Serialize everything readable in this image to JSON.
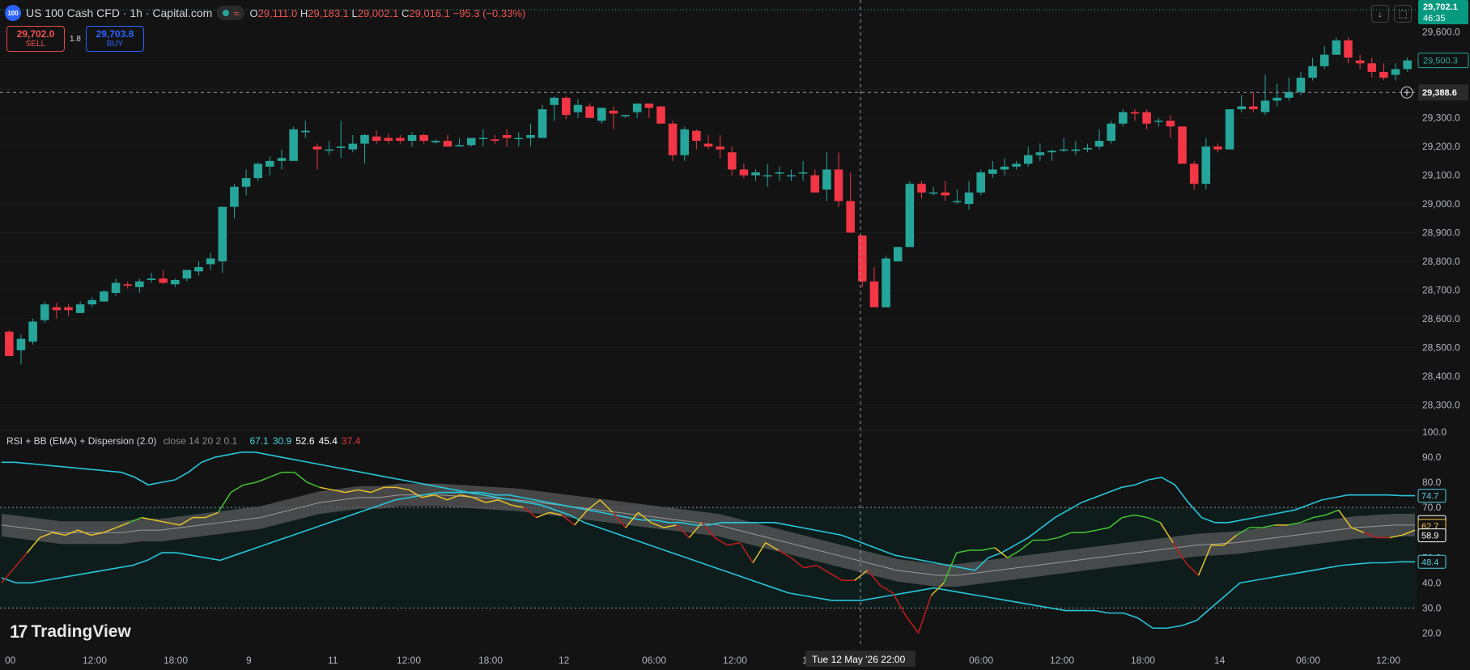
{
  "header": {
    "symbol_badge": "100",
    "title": "US 100 Cash CFD · 1h · Capital.com",
    "wave_icon": "≈",
    "ohlc": {
      "o_label": "O",
      "o": "29,111.0",
      "h_label": "H",
      "h": "29,183.1",
      "l_label": "L",
      "l": "29,002.1",
      "c_label": "C",
      "c": "29,016.1",
      "change": "−95.3 (−0.33%)"
    }
  },
  "trade": {
    "sell_price": "29,702.0",
    "sell_label": "SELL",
    "spread": "1.8",
    "buy_price": "29,703.8",
    "buy_label": "BUY"
  },
  "toolbar": {
    "arrow_icon": "↓",
    "frame_icon": "⬚"
  },
  "price_axis": {
    "ticks": [
      "29,600.0",
      "29,500.0",
      "29,400.0",
      "29,300.0",
      "29,200.0",
      "29,100.0",
      "29,000.0",
      "28,900.0",
      "28,800.0",
      "28,700.0",
      "28,600.0",
      "28,500.0",
      "28,400.0",
      "28,300.0"
    ],
    "current_price": "29,702.1",
    "countdown": "46:35",
    "marker_label": "29,500.3",
    "crosshair_label": "29,388.6"
  },
  "indicator": {
    "name": "RSI + BB (EMA) + Dispersion (2.0)",
    "params": "close 14 20 2 0.1",
    "values": [
      {
        "text": "67.1",
        "color": "#4dd0e1"
      },
      {
        "text": "30.9",
        "color": "#4dd0e1"
      },
      {
        "text": "52.6",
        "color": "#ffffff"
      },
      {
        "text": "45.4",
        "color": "#ffffff"
      },
      {
        "text": "37.4",
        "color": "#e53935"
      }
    ],
    "ticks": [
      "100.0",
      "90.0",
      "80.0",
      "70.0",
      "60.0",
      "50.0",
      "40.0",
      "30.0",
      "20.0"
    ],
    "labels": [
      {
        "text": "74.7",
        "v": 74.7,
        "bg": "#131313",
        "color": "#4dd0e1",
        "border": "#4dd0e1"
      },
      {
        "text": "64.2",
        "v": 64.2,
        "bg": "#131313",
        "color": "#ffffff",
        "border": "#ffffff"
      },
      {
        "text": "62.7",
        "v": 62.7,
        "bg": "#131313",
        "color": "#f5c542",
        "border": "#f5c542"
      },
      {
        "text": "58.9",
        "v": 58.9,
        "bg": "#131313",
        "color": "#ffffff",
        "border": "#ffffff"
      },
      {
        "text": "48.4",
        "v": 48.4,
        "bg": "#131313",
        "color": "#4dd0e1",
        "border": "#4dd0e1"
      }
    ]
  },
  "time_axis": {
    "labels": [
      "00",
      "12:00",
      "18:00",
      "9",
      "11",
      "12:00",
      "18:00",
      "12",
      "06:00",
      "12:00",
      "18",
      "22:00",
      "06:00",
      "12:00",
      "18:00",
      "14",
      "06:00",
      "12:00"
    ],
    "crosshair_label": "Tue 12 May '26  22:00"
  },
  "branding": {
    "name": "TradingView"
  },
  "colors": {
    "up": "#26a69a",
    "down": "#f23645",
    "bb": "#26c6da",
    "rsi_up": "#43c331",
    "rsi_mid": "#e6c229",
    "rsi_down": "#c41c1c",
    "band": "#5a5a5a",
    "accent": "#089981"
  },
  "chart_data": {
    "type": "candlestick",
    "price_ylim": [
      28250,
      29660
    ],
    "rsi_ylim": [
      15,
      100
    ],
    "candles": [
      [
        28555,
        28560,
        28470,
        28470
      ],
      [
        28490,
        28545,
        28440,
        28530
      ],
      [
        28520,
        28600,
        28510,
        28590
      ],
      [
        28595,
        28660,
        28585,
        28650
      ],
      [
        28640,
        28655,
        28600,
        28630
      ],
      [
        28640,
        28650,
        28610,
        28630
      ],
      [
        28620,
        28660,
        28620,
        28650
      ],
      [
        28650,
        28675,
        28640,
        28665
      ],
      [
        28660,
        28700,
        28660,
        28695
      ],
      [
        28690,
        28740,
        28680,
        28725
      ],
      [
        28720,
        28730,
        28705,
        28715
      ],
      [
        28710,
        28740,
        28690,
        28730
      ],
      [
        28735,
        28760,
        28725,
        28740
      ],
      [
        28740,
        28770,
        28720,
        28725
      ],
      [
        28720,
        28740,
        28710,
        28735
      ],
      [
        28740,
        28770,
        28730,
        28770
      ],
      [
        28765,
        28800,
        28750,
        28780
      ],
      [
        28790,
        28830,
        28770,
        28810
      ],
      [
        28800,
        28990,
        28760,
        28990
      ],
      [
        28990,
        29070,
        28950,
        29060
      ],
      [
        29060,
        29120,
        29030,
        29090
      ],
      [
        29090,
        29145,
        29080,
        29140
      ],
      [
        29130,
        29165,
        29100,
        29150
      ],
      [
        29150,
        29190,
        29120,
        29160
      ],
      [
        29150,
        29270,
        29150,
        29260
      ],
      [
        29250,
        29290,
        29230,
        29255
      ],
      [
        29200,
        29210,
        29120,
        29190
      ],
      [
        29190,
        29220,
        29170,
        29190
      ],
      [
        29195,
        29290,
        29160,
        29200
      ],
      [
        29190,
        29240,
        29180,
        29210
      ],
      [
        29210,
        29245,
        29140,
        29240
      ],
      [
        29235,
        29255,
        29210,
        29220
      ],
      [
        29230,
        29245,
        29210,
        29220
      ],
      [
        29230,
        29240,
        29210,
        29220
      ],
      [
        29220,
        29250,
        29200,
        29240
      ],
      [
        29240,
        29245,
        29210,
        29220
      ],
      [
        29215,
        29225,
        29210,
        29220
      ],
      [
        29220,
        29240,
        29200,
        29200
      ],
      [
        29205,
        29230,
        29200,
        29205
      ],
      [
        29205,
        29230,
        29200,
        29230
      ],
      [
        29230,
        29260,
        29200,
        29230
      ],
      [
        29225,
        29240,
        29210,
        29220
      ],
      [
        29240,
        29260,
        29200,
        29230
      ],
      [
        29230,
        29250,
        29200,
        29230
      ],
      [
        29230,
        29280,
        29200,
        29240
      ],
      [
        29230,
        29345,
        29230,
        29330
      ],
      [
        29345,
        29375,
        29290,
        29370
      ],
      [
        29370,
        29375,
        29295,
        29310
      ],
      [
        29320,
        29365,
        29300,
        29345
      ],
      [
        29340,
        29350,
        29300,
        29300
      ],
      [
        29290,
        29330,
        29280,
        29335
      ],
      [
        29325,
        29340,
        29260,
        29315
      ],
      [
        29310,
        29310,
        29300,
        29310
      ],
      [
        29320,
        29340,
        29300,
        29350
      ],
      [
        29350,
        29350,
        29300,
        29335
      ],
      [
        29340,
        29330,
        29280,
        29280
      ],
      [
        29280,
        29290,
        29150,
        29170
      ],
      [
        29170,
        29270,
        29150,
        29260
      ],
      [
        29255,
        29260,
        29190,
        29220
      ],
      [
        29210,
        29240,
        29190,
        29200
      ],
      [
        29200,
        29240,
        29160,
        29190
      ],
      [
        29180,
        29200,
        29100,
        29120
      ],
      [
        29120,
        29140,
        29090,
        29100
      ],
      [
        29100,
        29120,
        29080,
        29110
      ],
      [
        29100,
        29140,
        29060,
        29100
      ],
      [
        29110,
        29130,
        29080,
        29110
      ],
      [
        29100,
        29120,
        29080,
        29100
      ],
      [
        29110,
        29150,
        29080,
        29110
      ],
      [
        29100,
        29120,
        29040,
        29040
      ],
      [
        29050,
        29180,
        29010,
        29120
      ],
      [
        29120,
        29180,
        28990,
        29010
      ],
      [
        29010,
        29110,
        28900,
        28900
      ],
      [
        28890,
        28890,
        28710,
        28730
      ],
      [
        28730,
        28780,
        28640,
        28640
      ],
      [
        28640,
        28820,
        28640,
        28810
      ],
      [
        28800,
        28850,
        28800,
        28850
      ],
      [
        28850,
        29080,
        28850,
        29070
      ],
      [
        29070,
        29080,
        29020,
        29040
      ],
      [
        29040,
        29060,
        29030,
        29040
      ],
      [
        29040,
        29080,
        29010,
        29030
      ],
      [
        29010,
        29050,
        29000,
        29010
      ],
      [
        29000,
        29080,
        28980,
        29040
      ],
      [
        29040,
        29120,
        29030,
        29110
      ],
      [
        29105,
        29150,
        29090,
        29120
      ],
      [
        29120,
        29160,
        29100,
        29130
      ],
      [
        29130,
        29150,
        29120,
        29140
      ],
      [
        29140,
        29200,
        29130,
        29170
      ],
      [
        29170,
        29210,
        29150,
        29180
      ],
      [
        29180,
        29190,
        29150,
        29185
      ],
      [
        29190,
        29230,
        29180,
        29190
      ],
      [
        29185,
        29220,
        29170,
        29190
      ],
      [
        29190,
        29210,
        29180,
        29195
      ],
      [
        29200,
        29260,
        29190,
        29220
      ],
      [
        29220,
        29290,
        29210,
        29280
      ],
      [
        29280,
        29330,
        29270,
        29320
      ],
      [
        29320,
        29330,
        29290,
        29315
      ],
      [
        29320,
        29330,
        29260,
        29280
      ],
      [
        29290,
        29300,
        29270,
        29290
      ],
      [
        29290,
        29310,
        29230,
        29270
      ],
      [
        29270,
        29260,
        29180,
        29140
      ],
      [
        29140,
        29150,
        29050,
        29070
      ],
      [
        29070,
        29230,
        29050,
        29200
      ],
      [
        29200,
        29210,
        29180,
        29190
      ],
      [
        29190,
        29330,
        29190,
        29330
      ],
      [
        29330,
        29380,
        29320,
        29340
      ],
      [
        29340,
        29390,
        29320,
        29330
      ],
      [
        29320,
        29450,
        29310,
        29360
      ],
      [
        29360,
        29420,
        29340,
        29370
      ],
      [
        29370,
        29440,
        29360,
        29390
      ],
      [
        29390,
        29460,
        29380,
        29440
      ],
      [
        29440,
        29510,
        29430,
        29480
      ],
      [
        29480,
        29550,
        29470,
        29520
      ],
      [
        29520,
        29580,
        29520,
        29570
      ],
      [
        29570,
        29580,
        29490,
        29510
      ],
      [
        29500,
        29520,
        29470,
        29490
      ],
      [
        29490,
        29510,
        29440,
        29460
      ],
      [
        29460,
        29490,
        29430,
        29440
      ],
      [
        29450,
        29490,
        29430,
        29470
      ],
      [
        29470,
        29510,
        29460,
        29500
      ]
    ],
    "rsi": [
      40,
      46,
      52,
      58,
      60,
      59,
      61,
      59,
      60,
      62,
      64,
      66,
      65,
      64,
      63,
      66,
      66,
      68,
      76,
      79,
      80,
      82,
      84,
      84,
      80,
      78,
      77,
      76,
      77,
      76,
      78,
      78,
      77,
      74,
      75,
      73,
      75,
      74,
      72,
      73,
      71,
      70,
      66,
      68,
      67,
      63,
      69,
      73,
      68,
      62,
      68,
      64,
      62,
      63,
      58,
      64,
      58,
      55,
      56,
      48,
      56,
      53,
      50,
      46,
      47,
      44,
      41,
      41,
      45,
      39,
      36,
      27,
      20,
      35,
      40,
      52,
      53,
      53,
      54,
      50,
      53,
      57,
      57,
      58,
      60,
      60,
      61,
      62,
      66,
      67,
      66,
      64,
      56,
      48,
      43,
      55,
      55,
      59,
      62,
      62,
      63,
      63,
      64,
      66,
      67,
      69,
      62,
      60,
      58,
      58,
      59,
      61
    ],
    "bb_upper": [
      88,
      88,
      87.5,
      87,
      86.5,
      86,
      85.5,
      85,
      84.5,
      84,
      82,
      79,
      80,
      81,
      84,
      88,
      90,
      91,
      92,
      92,
      91,
      90,
      89,
      88,
      87,
      86,
      85,
      84,
      83,
      82,
      81,
      80,
      79,
      78,
      77,
      76,
      76,
      75,
      75,
      74,
      73,
      72,
      71,
      70,
      69,
      68,
      67,
      66,
      65,
      65,
      64,
      64,
      63,
      63,
      64,
      64,
      64,
      64,
      64,
      63,
      62,
      61,
      60,
      59,
      57,
      55,
      53,
      51,
      50,
      49,
      48,
      47,
      46,
      45,
      50,
      52,
      55,
      58,
      62,
      66,
      69,
      72,
      74,
      76,
      78,
      79,
      81,
      82,
      79,
      72,
      66,
      64,
      64,
      65,
      66,
      67,
      68,
      69,
      71,
      73,
      74,
      75,
      75,
      75,
      75,
      74.7,
      74.7
    ],
    "bb_lower": [
      42,
      40,
      40,
      41,
      42,
      43,
      44,
      45,
      46,
      47,
      49,
      52,
      52,
      51,
      50,
      49,
      51,
      53,
      55,
      57,
      59,
      61,
      63,
      65,
      67,
      69,
      71,
      73,
      74,
      75,
      76,
      76,
      76,
      75,
      74,
      73,
      72,
      71,
      69,
      67,
      64,
      62,
      60,
      58,
      56,
      54,
      52,
      50,
      48,
      46,
      44,
      42,
      40,
      38,
      36,
      35,
      34,
      33,
      33,
      33,
      34,
      35,
      36,
      37,
      38,
      37,
      36,
      35,
      34,
      33,
      32,
      31,
      30,
      29,
      29,
      29,
      28,
      28,
      26,
      22,
      22,
      23,
      25,
      30,
      35,
      40,
      41,
      42,
      43,
      44,
      45,
      46,
      47,
      47.5,
      48,
      48,
      48.4,
      48.4
    ],
    "band_mid": [
      63,
      62,
      61,
      60,
      60,
      60,
      60,
      61,
      61,
      62,
      63,
      64,
      65,
      66,
      68,
      70,
      72,
      73,
      74,
      74,
      75,
      75,
      75,
      74.5,
      74,
      73.5,
      73,
      72,
      71,
      70,
      69,
      68,
      67,
      66,
      65,
      64,
      63,
      61,
      59,
      57,
      55,
      53,
      51,
      49,
      47,
      45,
      44,
      43,
      43,
      44,
      45,
      46,
      47,
      48,
      49,
      50,
      51,
      52,
      53,
      54,
      55,
      55.5,
      56,
      57,
      58,
      59,
      60,
      61,
      62,
      62.5,
      63,
      63
    ],
    "hline_upper": 70,
    "hline_lower": 30
  }
}
